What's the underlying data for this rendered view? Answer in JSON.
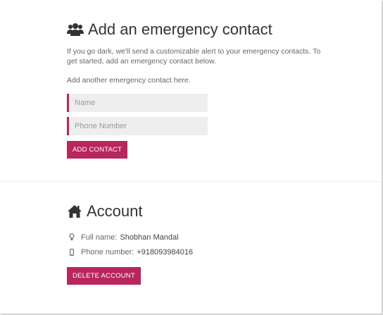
{
  "emergency": {
    "icon": "users-icon",
    "title": "Add an emergency contact",
    "description": "If you go dark, we'll send a customizable alert to your emergency contacts. To get started, add an emergency contact below.",
    "subtext": "Add another emergency contact here.",
    "name_placeholder": "Name",
    "phone_placeholder": "Phone Number",
    "add_button": "ADD CONTACT"
  },
  "account": {
    "icon": "home-icon",
    "title": "Account",
    "full_name_label": "Full name:",
    "full_name_value": "Shobhan Mandal",
    "phone_label": "Phone number:",
    "phone_value": "+918093984016",
    "delete_button": "DELETE ACCOUNT"
  },
  "colors": {
    "accent": "#b8265e",
    "field_bg": "#eeeeee"
  }
}
